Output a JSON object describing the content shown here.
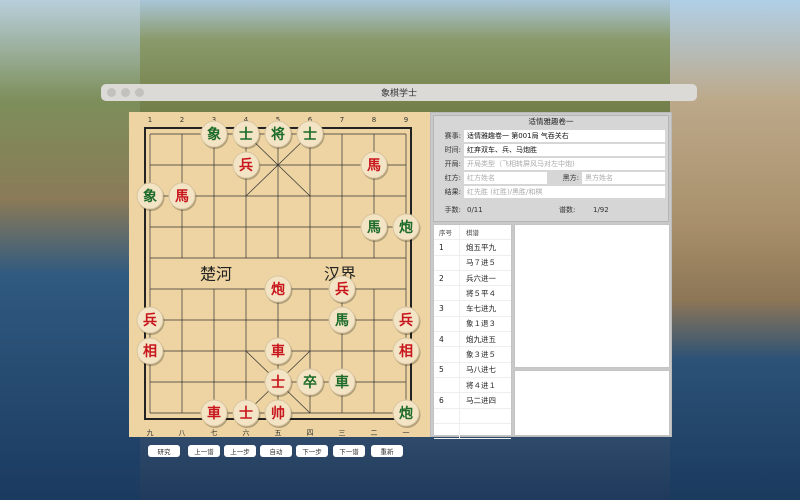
{
  "window": {
    "title": "象棋学士"
  },
  "board": {
    "top_numbers": [
      "1",
      "2",
      "3",
      "4",
      "5",
      "6",
      "7",
      "8",
      "9"
    ],
    "bottom_numbers": [
      "九",
      "八",
      "七",
      "六",
      "五",
      "四",
      "三",
      "二",
      "一"
    ],
    "river_left": "楚河",
    "river_right": "汉界",
    "colors": {
      "red": "#c8161d",
      "black": "#1d6b2a",
      "wood": "#edd4a2",
      "piece": "#f4e4c6"
    },
    "pieces": [
      {
        "ch": "象",
        "side": "black",
        "col": 2,
        "row": 0
      },
      {
        "ch": "士",
        "side": "black",
        "col": 3,
        "row": 0
      },
      {
        "ch": "将",
        "side": "black",
        "col": 4,
        "row": 0
      },
      {
        "ch": "士",
        "side": "black",
        "col": 5,
        "row": 0
      },
      {
        "ch": "兵",
        "side": "red",
        "col": 3,
        "row": 1
      },
      {
        "ch": "馬",
        "side": "red",
        "col": 7,
        "row": 1
      },
      {
        "ch": "象",
        "side": "black",
        "col": 0,
        "row": 2
      },
      {
        "ch": "馬",
        "side": "red",
        "col": 1,
        "row": 2
      },
      {
        "ch": "馬",
        "side": "black",
        "col": 7,
        "row": 3
      },
      {
        "ch": "炮",
        "side": "black",
        "col": 8,
        "row": 3
      },
      {
        "ch": "炮",
        "side": "red",
        "col": 4,
        "row": 5
      },
      {
        "ch": "兵",
        "side": "red",
        "col": 6,
        "row": 5
      },
      {
        "ch": "兵",
        "side": "red",
        "col": 0,
        "row": 6
      },
      {
        "ch": "馬",
        "side": "black",
        "col": 6,
        "row": 6
      },
      {
        "ch": "兵",
        "side": "red",
        "col": 8,
        "row": 6
      },
      {
        "ch": "相",
        "side": "red",
        "col": 0,
        "row": 7
      },
      {
        "ch": "車",
        "side": "red",
        "col": 4,
        "row": 7
      },
      {
        "ch": "相",
        "side": "red",
        "col": 8,
        "row": 7
      },
      {
        "ch": "士",
        "side": "red",
        "col": 4,
        "row": 8
      },
      {
        "ch": "卒",
        "side": "black",
        "col": 5,
        "row": 8
      },
      {
        "ch": "車",
        "side": "black",
        "col": 6,
        "row": 8
      },
      {
        "ch": "車",
        "side": "red",
        "col": 2,
        "row": 9
      },
      {
        "ch": "士",
        "side": "red",
        "col": 3,
        "row": 9
      },
      {
        "ch": "帅",
        "side": "red",
        "col": 4,
        "row": 9
      },
      {
        "ch": "炮",
        "side": "black",
        "col": 8,
        "row": 9
      }
    ]
  },
  "info": {
    "header": "适情雅趣卷一",
    "event_label": "赛事:",
    "event": "适情雅趣卷一 第001局 气吞关右",
    "time_label": "时间:",
    "time": "红弃双车、兵、马炮胜",
    "opening_label": "开局:",
    "opening_placeholder": "开局类型（飞相转屏风马对左中炮)",
    "red_label": "红方:",
    "red_placeholder": "红方姓名",
    "black_label": "黑方:",
    "black_placeholder": "黑方姓名",
    "result_label": "结果:",
    "result_placeholder": "红先胜 (红胜)/黑胜/和棋",
    "moves_label": "手数:",
    "moves_value": "0/11",
    "record_label": "谱数:",
    "record_value": "1/92"
  },
  "movelist": {
    "headers": [
      "序号",
      "棋谱"
    ],
    "rows": [
      [
        "1",
        "炮五平九"
      ],
      [
        "",
        "马７进５"
      ],
      [
        "2",
        "兵六进一"
      ],
      [
        "",
        "将５平４"
      ],
      [
        "3",
        "车七进九"
      ],
      [
        "",
        "象１退３"
      ],
      [
        "4",
        "炮九进五"
      ],
      [
        "",
        "象３进５"
      ],
      [
        "5",
        "马八进七"
      ],
      [
        "",
        "将４进１"
      ],
      [
        "6",
        "马二进四"
      ],
      [
        "",
        ""
      ],
      [
        "",
        ""
      ]
    ]
  },
  "buttons": [
    "研究",
    "上一谱",
    "上一步",
    "自动",
    "下一步",
    "下一谱",
    "重新"
  ]
}
